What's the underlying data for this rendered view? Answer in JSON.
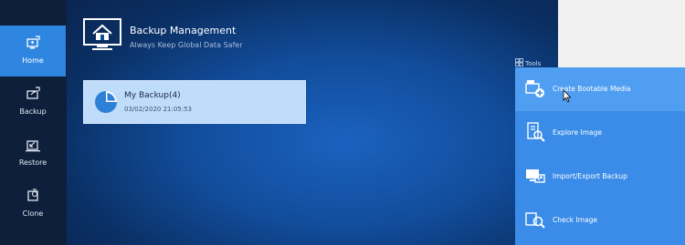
{
  "sidebar": {
    "items": [
      {
        "label": "Home",
        "icon": "home-icon",
        "active": true
      },
      {
        "label": "Backup",
        "icon": "backup-icon",
        "active": false
      },
      {
        "label": "Restore",
        "icon": "restore-icon",
        "active": false
      },
      {
        "label": "Clone",
        "icon": "clone-icon",
        "active": false
      }
    ]
  },
  "header": {
    "title": "Backup Management",
    "subtitle": "Always Keep Global Data Safer",
    "icon": "home-monitor-icon"
  },
  "backups": [
    {
      "name": "My Backup(4)",
      "date": "03/02/2020 21:05:53",
      "icon": "pie-chart-icon"
    }
  ],
  "tools": {
    "label": "Tools",
    "items": [
      {
        "label": "Create Bootable Media",
        "icon": "bootable-media-icon"
      },
      {
        "label": "Explore Image",
        "icon": "explore-image-icon"
      },
      {
        "label": "Import/Export Backup",
        "icon": "import-export-icon"
      },
      {
        "label": "Check Image",
        "icon": "check-image-icon"
      }
    ]
  },
  "colors": {
    "sidebar_bg": "#0e1f3b",
    "active_nav": "#2f86e0",
    "tools_panel": "#3a8ce8",
    "card_bg": "#bfdcfa"
  }
}
